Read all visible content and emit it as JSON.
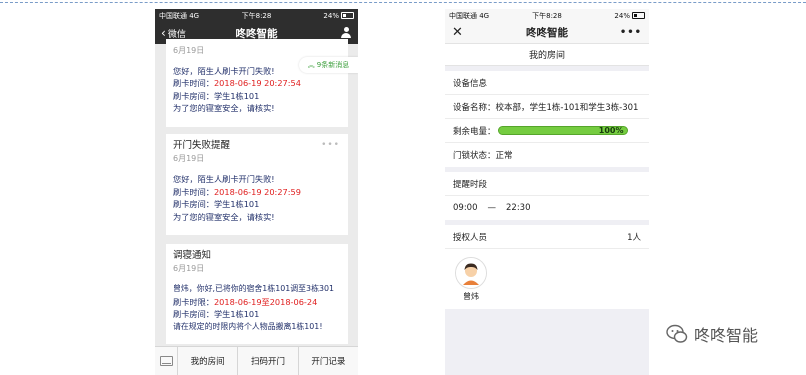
{
  "left_phone": {
    "status": {
      "carrier": "中国联通  4G",
      "time": "下午8:28",
      "battery": "24%"
    },
    "nav": {
      "back_label": "微信",
      "title": "咚咚智能"
    },
    "new_messages_toast": "9条新消息",
    "messages": [
      {
        "title": "",
        "date": "6月19日",
        "greeting": "您好，陌生人刷卡开门失败!",
        "time_label": "刷卡时间：",
        "time_value": "2018-06-19 20:27:54",
        "room_label": "刷卡房间：",
        "room_value": "学生1栋101",
        "note": "为了您的寝室安全，请核实!"
      },
      {
        "title": "开门失败提醒",
        "date": "6月19日",
        "greeting": "您好，陌生人刷卡开门失败!",
        "time_label": "刷卡时间：",
        "time_value": "2018-06-19 20:27:59",
        "room_label": "刷卡房间：",
        "room_value": "学生1栋101",
        "note": "为了您的寝室安全，请核实!"
      },
      {
        "title": "调寝通知",
        "date": "6月19日",
        "greeting": "曾炜，你好,已将你的宿舍1栋101调至3栋301",
        "time_label": "刷卡时限：",
        "time_value": "2018-06-19至2018-06-24",
        "room_label": "刷卡房间：",
        "room_value": "学生1栋101",
        "note": "请在规定的时限内将个人物品搬离1栋101!"
      }
    ],
    "bottom_menu": [
      "我的房间",
      "扫码开门",
      "开门记录"
    ]
  },
  "right_phone": {
    "status": {
      "carrier": "中国联通  4G",
      "time": "下午8:28",
      "battery": "24%"
    },
    "nav": {
      "title": "咚咚智能"
    },
    "page_title": "我的房间",
    "device_section": {
      "header": "设备信息",
      "name_label": "设备名称：",
      "name_value": "校本部，学生1栋-101和学生3栋-301",
      "power_label": "剩余电量：",
      "power_percent": 100,
      "power_text": "100%",
      "lock_label": "门锁状态：",
      "lock_value": "正常"
    },
    "reminder_section": {
      "header": "提醒时段",
      "start": "09:00",
      "dash": "—",
      "end": "22:30"
    },
    "authorized_section": {
      "header": "授权人员",
      "count": "1人",
      "members": [
        {
          "name": "曾炜"
        }
      ]
    }
  },
  "watermark": {
    "text": "咚咚智能"
  },
  "colors": {
    "accent_green": "#75cc40",
    "alert_red": "#e02020",
    "link_blue": "#22306a",
    "toast_green": "#3a9e3a"
  }
}
